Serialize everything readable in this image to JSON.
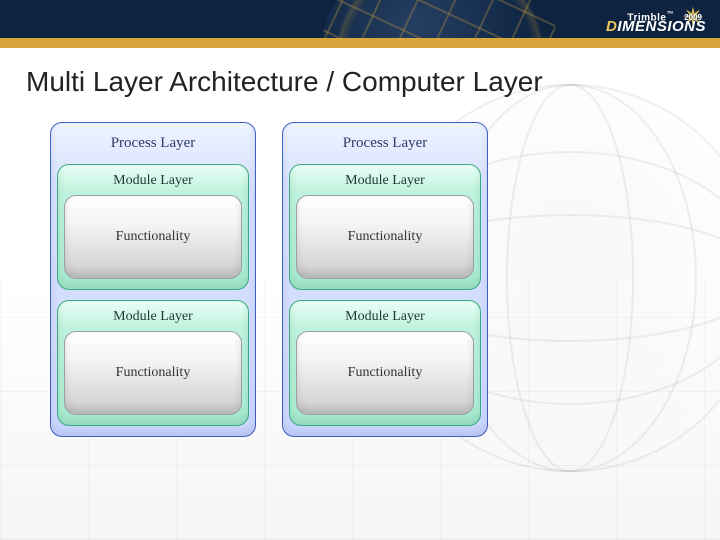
{
  "brand": {
    "name": "Trimble",
    "year": "2009",
    "product": "DIMENSIONS",
    "product_accent_prefix": "D",
    "product_rest": "IMENSIONS"
  },
  "slide": {
    "title": "Multi Layer Architecture / Computer Layer"
  },
  "diagram": {
    "columns": [
      {
        "process_label": "Process Layer",
        "modules": [
          {
            "module_label": "Module Layer",
            "functionality_label": "Functionality"
          },
          {
            "module_label": "Module Layer",
            "functionality_label": "Functionality"
          }
        ]
      },
      {
        "process_label": "Process Layer",
        "modules": [
          {
            "module_label": "Module Layer",
            "functionality_label": "Functionality"
          },
          {
            "module_label": "Module Layer",
            "functionality_label": "Functionality"
          }
        ]
      }
    ]
  }
}
